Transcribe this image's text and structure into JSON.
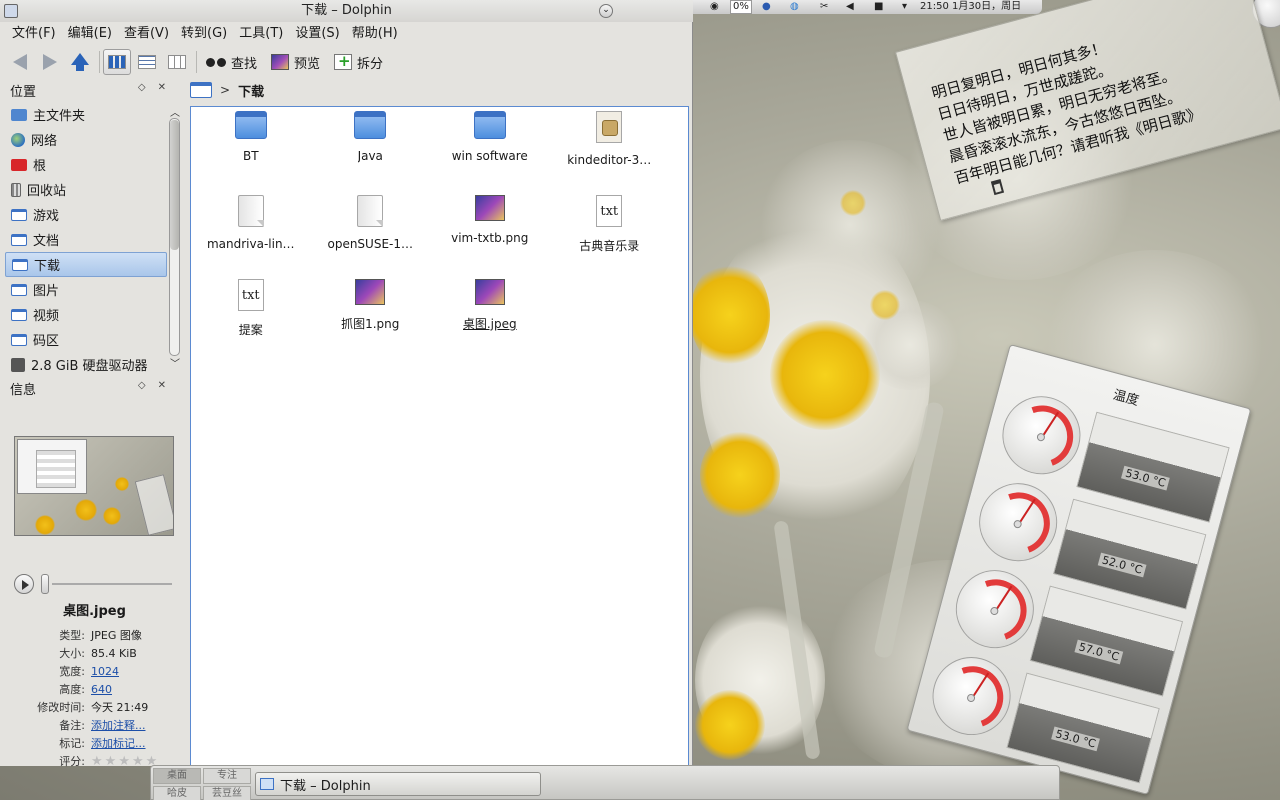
{
  "window": {
    "title": "下载 – Dolphin",
    "menu": [
      "文件(F)",
      "编辑(E)",
      "查看(V)",
      "转到(G)",
      "工具(T)",
      "设置(S)",
      "帮助(H)"
    ],
    "toolbar": {
      "find": "查找",
      "preview": "预览",
      "split": "拆分"
    }
  },
  "places": {
    "title": "位置",
    "items": [
      {
        "label": "主文件夹",
        "icon": "home-icon"
      },
      {
        "label": "网络",
        "icon": "network-icon"
      },
      {
        "label": "根",
        "icon": "root-folder-icon"
      },
      {
        "label": "回收站",
        "icon": "trash-icon"
      },
      {
        "label": "游戏",
        "icon": "folder-icon"
      },
      {
        "label": "文档",
        "icon": "folder-icon"
      },
      {
        "label": "下载",
        "icon": "folder-icon",
        "selected": true
      },
      {
        "label": "图片",
        "icon": "folder-icon"
      },
      {
        "label": "视频",
        "icon": "folder-icon"
      },
      {
        "label": "码区",
        "icon": "folder-icon"
      },
      {
        "label": "2.8 GiB 硬盘驱动器",
        "icon": "drive-icon"
      }
    ]
  },
  "info": {
    "title": "信息",
    "file_name": "桌图.jpeg",
    "rows": [
      {
        "k": "类型:",
        "v": "JPEG 图像"
      },
      {
        "k": "大小:",
        "v": "85.4 KiB"
      },
      {
        "k": "宽度:",
        "v": "1024",
        "link": true
      },
      {
        "k": "高度:",
        "v": "640",
        "link": true
      },
      {
        "k": "修改时间:",
        "v": "今天 21:49"
      },
      {
        "k": "备注:",
        "v": "添加注释...",
        "link": true
      },
      {
        "k": "标记:",
        "v": "添加标记...",
        "link": true
      }
    ],
    "rating_label": "评分:",
    "rating": 0
  },
  "location": {
    "crumb": "下载"
  },
  "files": [
    {
      "name": "BT",
      "type": "folder"
    },
    {
      "name": "Java",
      "type": "folder"
    },
    {
      "name": "win software",
      "type": "folder"
    },
    {
      "name": "kindeditor-3…",
      "type": "archive"
    },
    {
      "name": "mandriva-lin…",
      "type": "file"
    },
    {
      "name": "openSUSE-1…",
      "type": "file"
    },
    {
      "name": "vim-txtb.png",
      "type": "image"
    },
    {
      "name": "古典音乐录",
      "type": "text"
    },
    {
      "name": "提案",
      "type": "text"
    },
    {
      "name": "抓图1.png",
      "type": "image"
    },
    {
      "name": "桌图.jpeg",
      "type": "image",
      "selected": true
    }
  ],
  "taskbar": {
    "pager": [
      "桌面",
      "专注",
      "哈皮",
      "芸豆丝"
    ],
    "task": "下载 – Dolphin"
  },
  "top_panel": {
    "percent": "0%",
    "clock": "21:50 1月30日，周日"
  },
  "poem": {
    "lines": [
      "明日复明日，明日何其多！",
      "日日待明日，万世成蹉跎。",
      "世人皆被明日累，明日无穷老将至。",
      "晨昏滚滚水流东，今古悠悠日西坠。",
      "百年明日能几何？请君听我《明日歌》"
    ]
  },
  "temperature": {
    "title": "温度",
    "sensors": [
      {
        "value": "53.0 °C"
      },
      {
        "value": "52.0 °C"
      },
      {
        "value": "57.0 °C"
      },
      {
        "value": "53.0 °C"
      }
    ]
  }
}
